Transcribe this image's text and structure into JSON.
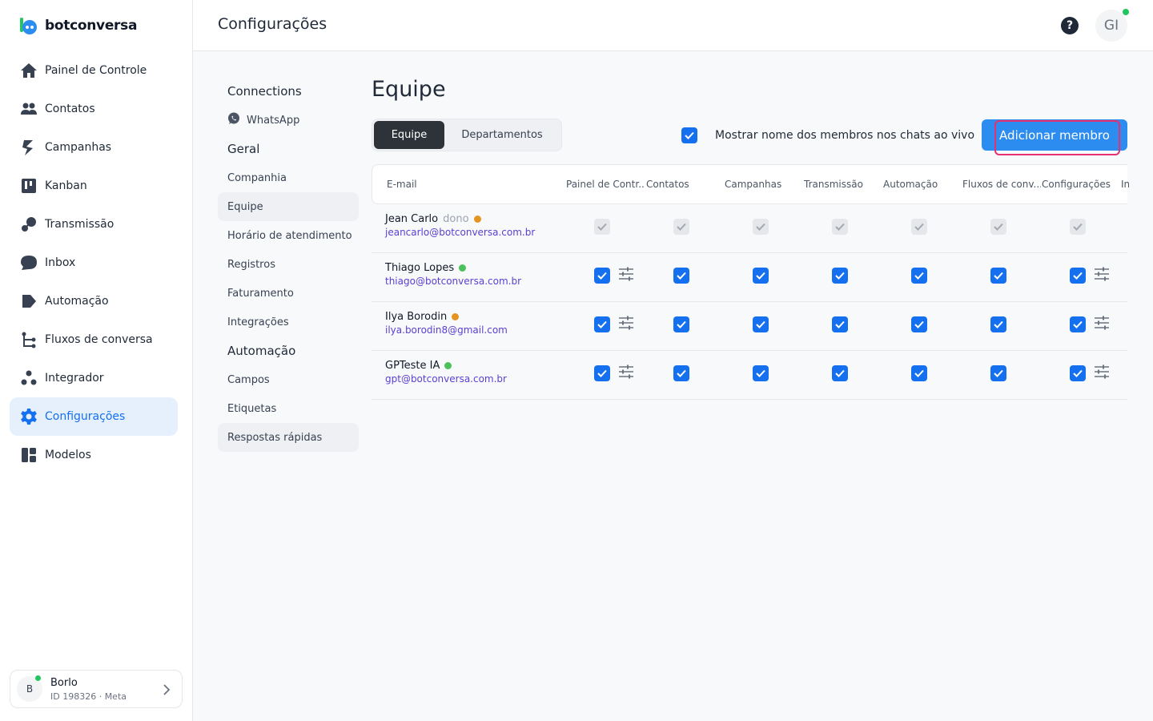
{
  "app": {
    "logo_text": "botconversa"
  },
  "sidebar": {
    "items": [
      {
        "label": "Painel de Controle",
        "icon": "home-icon"
      },
      {
        "label": "Contatos",
        "icon": "users-icon"
      },
      {
        "label": "Campanhas",
        "icon": "campaign-icon"
      },
      {
        "label": "Kanban",
        "icon": "kanban-icon"
      },
      {
        "label": "Transmissão",
        "icon": "broadcast-icon"
      },
      {
        "label": "Inbox",
        "icon": "chat-bubble-icon"
      },
      {
        "label": "Automação",
        "icon": "automation-icon"
      },
      {
        "label": "Fluxos de conversa",
        "icon": "flow-icon"
      },
      {
        "label": "Integrador",
        "icon": "integrator-icon"
      },
      {
        "label": "Configurações",
        "icon": "gear-icon"
      },
      {
        "label": "Modelos",
        "icon": "templates-icon"
      }
    ],
    "active_index": 9,
    "account": {
      "initial": "B",
      "name": "Borlo",
      "id_line": "ID 198326 · Meta"
    }
  },
  "header": {
    "title": "Configurações",
    "help_glyph": "?",
    "user_initials": "GI"
  },
  "settings_nav": {
    "sections": [
      {
        "title": "Connections",
        "items": [
          "WhatsApp"
        ]
      },
      {
        "title": "Geral",
        "items": [
          "Companhia",
          "Equipe",
          "Horário de atendimento",
          "Registros",
          "Faturamento",
          "Integrações"
        ]
      },
      {
        "title": "Automação",
        "items": [
          "Campos",
          "Etiquetas",
          "Respostas rápidas"
        ]
      }
    ],
    "active_item": "Equipe",
    "hover_item": "Respostas rápidas"
  },
  "main": {
    "title": "Equipe",
    "tabs": [
      "Equipe",
      "Departamentos"
    ],
    "active_tab": "Equipe",
    "show_names_label": "Mostrar nome dos membros nos chats ao vivo",
    "show_names_checked": true,
    "add_button_label": "Adicionar membro"
  },
  "table": {
    "columns": [
      "E-mail",
      "Painel de Contr...",
      "Contatos",
      "Campanhas",
      "Transmissão",
      "Automação",
      "Fluxos de conv...",
      "Configurações",
      "In"
    ],
    "rows": [
      {
        "name": "Jean Carlo",
        "role": "dono",
        "status_color": "#e69420",
        "email": "jeancarlo@botconversa.com.br",
        "checks_state": "disabled",
        "tunable": false
      },
      {
        "name": "Thiago Lopes",
        "role": "",
        "status_color": "#4cc05a",
        "email": "thiago@botconversa.com.br",
        "checks_state": "checked",
        "tunable": true
      },
      {
        "name": "Ilya Borodin",
        "role": "",
        "status_color": "#e69420",
        "email": "ilya.borodin8@gmail.com",
        "checks_state": "checked",
        "tunable": true
      },
      {
        "name": "GPTeste IA",
        "role": "",
        "status_color": "#4cc05a",
        "email": "gpt@botconversa.com.br",
        "checks_state": "checked",
        "tunable": true
      }
    ]
  },
  "colors": {
    "accent": "#1570ef",
    "button": "#2d8cf0",
    "highlight_ring": "#e8306e",
    "online": "#22c55e"
  }
}
